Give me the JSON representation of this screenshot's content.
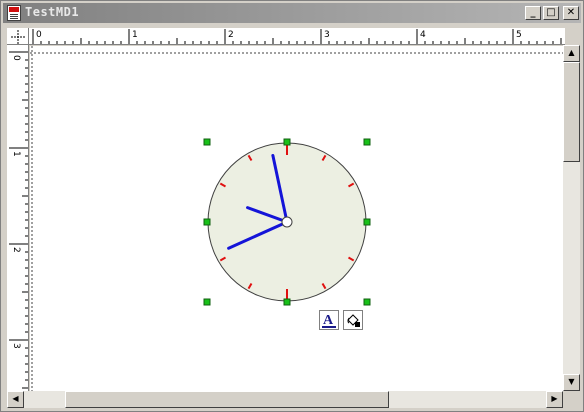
{
  "window": {
    "title": "TestMD1",
    "minimize_glyph": "_",
    "maximize_glyph": "□",
    "close_glyph": "✕"
  },
  "rulers": {
    "horizontal_labels": [
      "0",
      "1",
      "2",
      "3",
      "4",
      "5"
    ],
    "vertical_labels": [
      "0",
      "1",
      "2",
      "3"
    ]
  },
  "clock": {
    "hour": 9,
    "minute": 40,
    "second": 58,
    "face_color": "#ecefe2",
    "hand_color": "#1414d8",
    "tick_color": "#e01010",
    "handle_color": "#18c018"
  },
  "floating_tools": {
    "text_tool_icon": "text-format-icon",
    "fill_tool_icon": "paint-bucket-icon"
  },
  "scroll_arrows": {
    "up": "▲",
    "down": "▼",
    "left": "◀",
    "right": "▶"
  }
}
